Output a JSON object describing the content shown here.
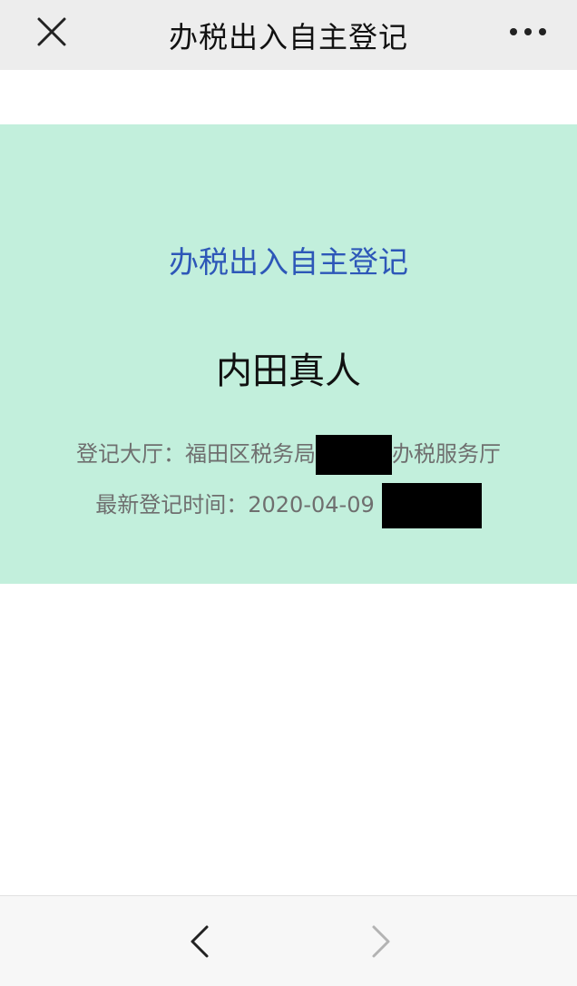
{
  "header": {
    "title": "办税出入自主登记"
  },
  "card": {
    "title": "办税出入自主登记",
    "name": "内田真人",
    "hall_label": "登记大厅：",
    "hall_prefix": "福田区税务局",
    "hall_suffix": "办税服务厅",
    "time_label": "最新登记时间：",
    "date": "2020-04-09"
  },
  "icons": {
    "close": "close-icon",
    "more": "more-horizontal-icon",
    "back": "chevron-left-icon",
    "forward": "chevron-right-icon"
  },
  "colors": {
    "header_bg": "#ededed",
    "card_bg": "#c2efdc",
    "card_title": "#2d57b8",
    "muted_text": "#6f6f6f"
  }
}
